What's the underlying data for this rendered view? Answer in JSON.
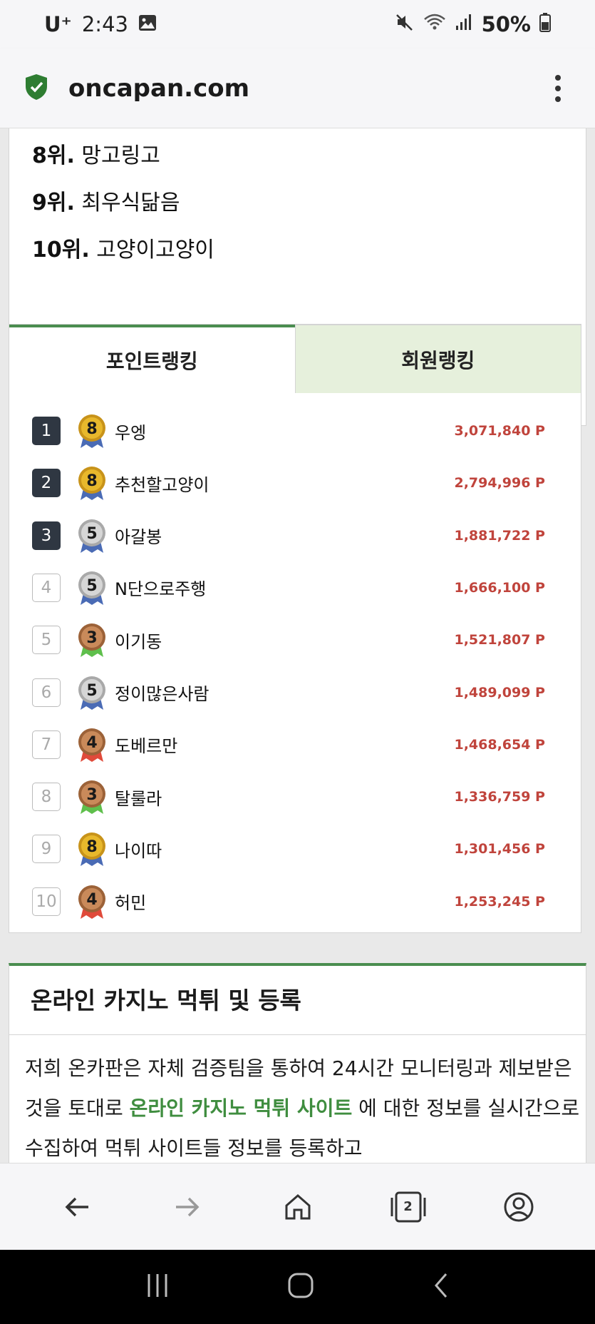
{
  "status_bar": {
    "carrier": "U⁺",
    "time": "2:43",
    "battery": "50%",
    "icons": [
      "image-icon",
      "mute-icon",
      "wifi-icon",
      "signal-icon",
      "battery-icon"
    ]
  },
  "browser": {
    "url": "oncapan.com",
    "tab_count": "2"
  },
  "top_ranks": [
    {
      "rank": "8위.",
      "name": "망고링고"
    },
    {
      "rank": "9위.",
      "name": "최우식닮음"
    },
    {
      "rank": "10위.",
      "name": "고양이고양이"
    }
  ],
  "ranking": {
    "tabs": [
      {
        "label": "포인트랭킹",
        "active": true
      },
      {
        "label": "회원랭킹",
        "active": false
      }
    ],
    "rows": [
      {
        "num": "1",
        "level": "8",
        "name": "우엥",
        "points": "3,071,840 P"
      },
      {
        "num": "2",
        "level": "8",
        "name": "추천할고양이",
        "points": "2,794,996 P"
      },
      {
        "num": "3",
        "level": "5",
        "name": "아갈봉",
        "points": "1,881,722 P"
      },
      {
        "num": "4",
        "level": "5",
        "name": "N단으로주행",
        "points": "1,666,100 P"
      },
      {
        "num": "5",
        "level": "3",
        "name": "이기동",
        "points": "1,521,807 P"
      },
      {
        "num": "6",
        "level": "5",
        "name": "정이많은사람",
        "points": "1,489,099 P"
      },
      {
        "num": "7",
        "level": "4",
        "name": "도베르만",
        "points": "1,468,654 P"
      },
      {
        "num": "8",
        "level": "3",
        "name": "탈룰라",
        "points": "1,336,759 P"
      },
      {
        "num": "9",
        "level": "8",
        "name": "나이따",
        "points": "1,301,456 P"
      },
      {
        "num": "10",
        "level": "4",
        "name": "허민",
        "points": "1,253,245 P"
      }
    ]
  },
  "casino": {
    "title": "온라인 카지노 먹튀 및 등록",
    "body_before": "저희 온카판은 자체 검증팀을 통하여 24시간 모니터링과 제보받은 것을 토대로 ",
    "body_link": "온라인 카지노 먹튀 사이트",
    "body_after": " 에 대한 정보를 실시간으로 수집하여 먹튀 사이트들 정보를 등록하고"
  },
  "colors": {
    "accent_green": "#4a8d4f",
    "points_red": "#c0443c",
    "tab_inactive_bg": "#e6f0dc"
  }
}
